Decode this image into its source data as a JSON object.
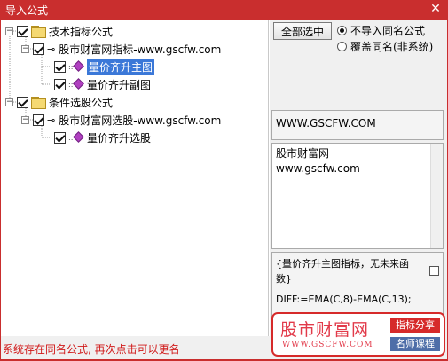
{
  "window": {
    "title": "导入公式",
    "close_glyph": "✕",
    "title_color": "#c92e2e"
  },
  "tree": {
    "nodes": [
      {
        "label": "技术指标公式"
      },
      {
        "label": "股市财富网指标-www.gscfw.com"
      },
      {
        "label": "量价齐升主图",
        "selected": true
      },
      {
        "label": "量价齐升副图"
      },
      {
        "label": "条件选股公式"
      },
      {
        "label": "股市财富网选股-www.gscfw.com"
      },
      {
        "label": "量价齐升选股"
      }
    ],
    "key_glyph": "⊸",
    "expander_glyph": "−",
    "selection_color": "#3b78d8"
  },
  "options": {
    "select_all_label": "全部选中",
    "radio_no_import": "不导入同名公式",
    "radio_overwrite": "覆盖同名(非系统)"
  },
  "info": {
    "url": "WWW.GSCFW.COM",
    "desc_line1": "股市财富网",
    "desc_line2": "www.gscfw.com",
    "formula_line1": "{量价齐升主图指标，无未来函",
    "formula_line2": "数}",
    "formula_line3": "DIFF:=EMA(C,8)-EMA(C,13);"
  },
  "status": {
    "message": "系统存在同名公式, 再次点击可以更名",
    "color": "#d01818"
  },
  "banner": {
    "name": "股市财富网",
    "url": "WWW.GSCFW.COM",
    "tag1": "指标分享",
    "tag2": "名师课程"
  }
}
